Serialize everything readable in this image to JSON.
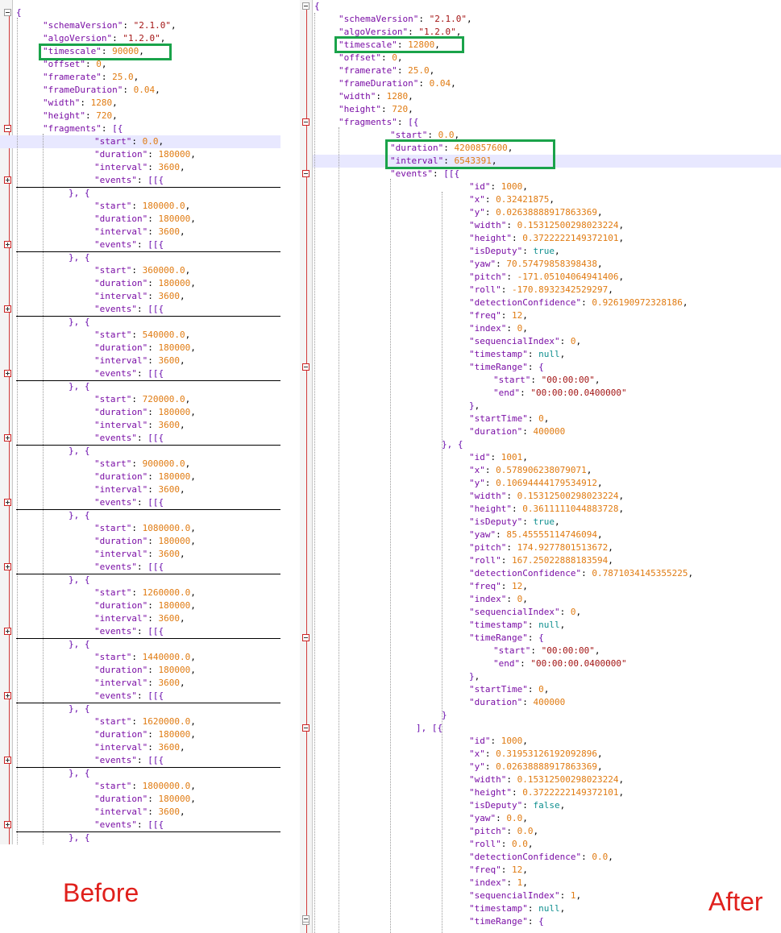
{
  "captions": {
    "before": "Before",
    "after": "After"
  },
  "before": {
    "header": [
      [
        "schemaVersion",
        "\"2.1.0\""
      ],
      [
        "algoVersion",
        "\"1.2.0\""
      ],
      [
        "timescale",
        "90000"
      ],
      [
        "offset",
        "0"
      ],
      [
        "framerate",
        "25.0"
      ],
      [
        "frameDuration",
        "0.04"
      ],
      [
        "width",
        "1280"
      ],
      [
        "height",
        "720"
      ]
    ],
    "fragments_key": "fragments",
    "events_key": "events",
    "fragment_keys": [
      "start",
      "duration",
      "interval"
    ],
    "fragments": [
      {
        "start": "0.0",
        "duration": "180000",
        "interval": "3600"
      },
      {
        "start": "180000.0",
        "duration": "180000",
        "interval": "3600"
      },
      {
        "start": "360000.0",
        "duration": "180000",
        "interval": "3600"
      },
      {
        "start": "540000.0",
        "duration": "180000",
        "interval": "3600"
      },
      {
        "start": "720000.0",
        "duration": "180000",
        "interval": "3600"
      },
      {
        "start": "900000.0",
        "duration": "180000",
        "interval": "3600"
      },
      {
        "start": "1080000.0",
        "duration": "180000",
        "interval": "3600"
      },
      {
        "start": "1260000.0",
        "duration": "180000",
        "interval": "3600"
      },
      {
        "start": "1440000.0",
        "duration": "180000",
        "interval": "3600"
      },
      {
        "start": "1620000.0",
        "duration": "180000",
        "interval": "3600"
      },
      {
        "start": "1800000.0",
        "duration": "180000",
        "interval": "3600"
      }
    ]
  },
  "after": {
    "header": [
      [
        "schemaVersion",
        "\"2.1.0\""
      ],
      [
        "algoVersion",
        "\"1.2.0\""
      ],
      [
        "timescale",
        "12800"
      ],
      [
        "offset",
        "0"
      ],
      [
        "framerate",
        "25.0"
      ],
      [
        "frameDuration",
        "0.04"
      ],
      [
        "width",
        "1280"
      ],
      [
        "height",
        "720"
      ]
    ],
    "fragments_key": "fragments",
    "fragment": {
      "start": "0.0",
      "duration": "4200857600",
      "interval": "6543391"
    },
    "events_key": "events",
    "time_range_key": "timeRange",
    "events": [
      [
        {
          "fields": [
            [
              "id",
              "1000"
            ],
            [
              "x",
              "0.32421875"
            ],
            [
              "y",
              "0.02638888917863369"
            ],
            [
              "width",
              "0.15312500298023224"
            ],
            [
              "height",
              "0.3722222149372101"
            ],
            [
              "isDeputy",
              "true"
            ],
            [
              "yaw",
              "70.57479858398438"
            ],
            [
              "pitch",
              "-171.05104064941406"
            ],
            [
              "roll",
              "-170.8932342529297"
            ],
            [
              "detectionConfidence",
              "0.926190972328186"
            ],
            [
              "freq",
              "12"
            ],
            [
              "index",
              "0"
            ],
            [
              "sequencialIndex",
              "0"
            ],
            [
              "timestamp",
              "null"
            ]
          ],
          "timeRange": {
            "start": "\"00:00:00\"",
            "end": "\"00:00:00.0400000\""
          },
          "tail": [
            [
              "startTime",
              "0"
            ],
            [
              "duration",
              "400000"
            ]
          ]
        },
        {
          "fields": [
            [
              "id",
              "1001"
            ],
            [
              "x",
              "0.578906238079071"
            ],
            [
              "y",
              "0.10694444179534912"
            ],
            [
              "width",
              "0.15312500298023224"
            ],
            [
              "height",
              "0.3611111044883728"
            ],
            [
              "isDeputy",
              "true"
            ],
            [
              "yaw",
              "85.45555114746094"
            ],
            [
              "pitch",
              "174.9277801513672"
            ],
            [
              "roll",
              "167.25022888183594"
            ],
            [
              "detectionConfidence",
              "0.7871034145355225"
            ],
            [
              "freq",
              "12"
            ],
            [
              "index",
              "0"
            ],
            [
              "sequencialIndex",
              "0"
            ],
            [
              "timestamp",
              "null"
            ]
          ],
          "timeRange": {
            "start": "\"00:00:00\"",
            "end": "\"00:00:00.0400000\""
          },
          "tail": [
            [
              "startTime",
              "0"
            ],
            [
              "duration",
              "400000"
            ]
          ]
        }
      ],
      [
        {
          "fields": [
            [
              "id",
              "1000"
            ],
            [
              "x",
              "0.31953126192092896"
            ],
            [
              "y",
              "0.02638888917863369"
            ],
            [
              "width",
              "0.15312500298023224"
            ],
            [
              "height",
              "0.3722222149372101"
            ],
            [
              "isDeputy",
              "false"
            ],
            [
              "yaw",
              "0.0"
            ],
            [
              "pitch",
              "0.0"
            ],
            [
              "roll",
              "0.0"
            ],
            [
              "detectionConfidence",
              "0.0"
            ],
            [
              "freq",
              "12"
            ],
            [
              "index",
              "1"
            ],
            [
              "sequencialIndex",
              "1"
            ],
            [
              "timestamp",
              "null"
            ]
          ],
          "partial": true
        }
      ]
    ]
  }
}
